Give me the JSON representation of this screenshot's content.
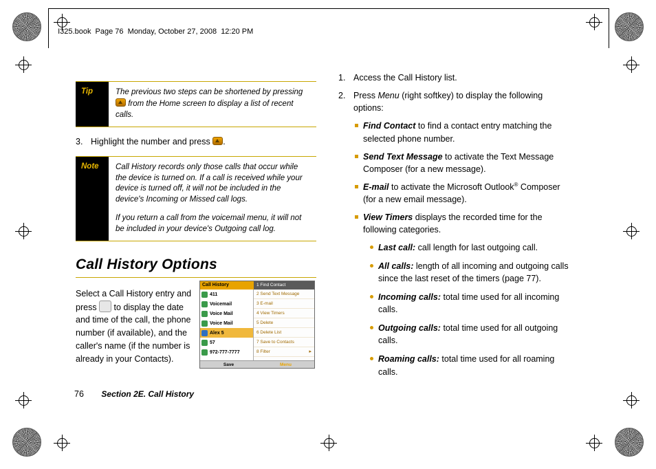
{
  "header": {
    "text": "I325.book  Page 76  Monday, October 27, 2008  12:20 PM"
  },
  "left_column": {
    "tip_callout": {
      "label": "Tip",
      "text_before_icon": "The previous two steps can be shortened by pressing",
      "text_after_icon": "from the Home screen to display a list of recent calls."
    },
    "step3": {
      "number": "3.",
      "text_before_icon": "Highlight the number and press",
      "text_after_icon": "."
    },
    "note_callout": {
      "label": "Note",
      "paragraph1": "Call History records only those calls that occur while the device is turned on. If a call is received while your device is turned off, it will not be included in the device's Incoming or Missed call logs.",
      "paragraph2": "If you return a call from the voicemail menu, it will not be included in your device's Outgoing call log."
    },
    "section_title": "Call History Options",
    "body_paragraph_before_icon": "Select a Call History entry and press",
    "body_paragraph_after_icon": "to display the date and time of the call, the phone number (if available), and the caller's name (if the number is already in your Contacts)."
  },
  "phone_screenshot": {
    "title": "Call History",
    "menu_title": "1 Find Contact",
    "list_items": [
      {
        "label": "411",
        "selected": false,
        "icon": "missed-call-icon"
      },
      {
        "label": "Voicemail",
        "selected": false,
        "icon": "voicemail-icon"
      },
      {
        "label": "Voice Mail",
        "selected": false,
        "icon": "voicemail-icon"
      },
      {
        "label": "Voice Mail",
        "selected": false,
        "icon": "voicemail-icon"
      },
      {
        "label": "Alex 5",
        "selected": true,
        "icon": "contact-icon"
      },
      {
        "label": "57",
        "selected": false,
        "icon": "outgoing-call-icon"
      },
      {
        "label": "972-777-7777",
        "selected": false,
        "icon": "incoming-call-icon"
      }
    ],
    "menu_items": [
      {
        "label": "2 Send Text Message",
        "arrow": false
      },
      {
        "label": "3 E-mail",
        "arrow": false
      },
      {
        "label": "4 View Timers",
        "arrow": false
      },
      {
        "label": "5 Delete",
        "arrow": false
      },
      {
        "label": "6 Delete List",
        "arrow": false
      },
      {
        "label": "7 Save to Contacts",
        "arrow": false
      },
      {
        "label": "8 Filter",
        "arrow": true
      }
    ],
    "softkey_left": "Save",
    "softkey_right": "Menu"
  },
  "right_column": {
    "steps": [
      {
        "number": "1.",
        "text": "Access the Call History list."
      },
      {
        "number": "2.",
        "text_parts": {
          "before": "Press ",
          "italic": "Menu",
          "after": " (right softkey) to display the following options:"
        }
      }
    ],
    "options": [
      {
        "term": "Find Contact",
        "text": " to find a contact entry matching the selected phone number."
      },
      {
        "term": "Send Text Message",
        "text": " to activate the Text Message Composer (for a new message)."
      },
      {
        "term": "E-mail",
        "text": " to activate the Microsoft Outlook",
        "sup": "®",
        "text2": " Composer (for a new email message)."
      },
      {
        "term": "View Timers",
        "text": " displays the recorded time for the following categories."
      }
    ],
    "timer_categories": [
      {
        "term": "Last call:",
        "text": " call length for last outgoing call."
      },
      {
        "term": "All calls:",
        "text": " length of all incoming and outgoing calls since the last reset of the timers (page 77)."
      },
      {
        "term": "Incoming calls:",
        "text": " total time used for all incoming calls."
      },
      {
        "term": "Outgoing calls:",
        "text": " total time used for all outgoing calls."
      },
      {
        "term": "Roaming calls:",
        "text": " total time used for all roaming calls."
      }
    ]
  },
  "footer": {
    "page_number": "76",
    "section": "Section 2E. Call History"
  },
  "colors": {
    "gold_rule": "#c7a600",
    "callout_label": "#e8b700",
    "bullet_square": "#d79b00",
    "phone_titlebar": "#e8a300"
  }
}
